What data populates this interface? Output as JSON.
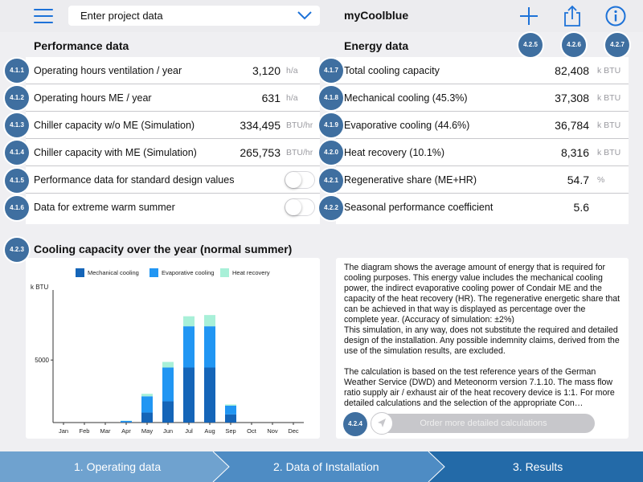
{
  "header": {
    "project_select_label": "Enter project data",
    "app_title": "myCoolblue",
    "icons": [
      "menu-icon",
      "chevron-down-icon",
      "plus-icon",
      "share-icon",
      "info-icon"
    ],
    "icon_badges": [
      "4.2.5",
      "4.2.6",
      "4.2.7"
    ]
  },
  "colors": {
    "accent": "#1d72d8",
    "badge": "#3f6fa0",
    "mechanical": "#1565b8",
    "evaporative": "#2196f3",
    "heat_recovery": "#a8f0d8",
    "step_light": "#6fa2cf",
    "step_mid": "#4e8cc4",
    "step_active": "#236aa8"
  },
  "performance": {
    "title": "Performance data",
    "rows": [
      {
        "badge": "4.1.1",
        "label": "Operating hours ventilation / year",
        "value": "3,120",
        "unit": "h/a"
      },
      {
        "badge": "4.1.2",
        "label": "Operating hours ME / year",
        "value": "631",
        "unit": "h/a"
      },
      {
        "badge": "4.1.3",
        "label": "Chiller capacity w/o ME (Simulation)",
        "value": "334,495",
        "unit": "BTU/hr"
      },
      {
        "badge": "4.1.4",
        "label": "Chiller capacity with ME (Simulation)",
        "value": "265,753",
        "unit": "BTU/hr"
      },
      {
        "badge": "4.1.5",
        "label": "Performance data for standard design values",
        "toggle": false
      },
      {
        "badge": "4.1.6",
        "label": "Data for extreme warm summer",
        "toggle": false
      }
    ]
  },
  "energy": {
    "title": "Energy data",
    "rows": [
      {
        "badge": "4.1.7",
        "label": "Total cooling capacity",
        "value": "82,408",
        "unit": "k BTU"
      },
      {
        "badge": "4.1.8",
        "label": "Mechanical cooling (45.3%)",
        "value": "37,308",
        "unit": "k BTU"
      },
      {
        "badge": "4.1.9",
        "label": "Evaporative cooling (44.6%)",
        "value": "36,784",
        "unit": "k BTU"
      },
      {
        "badge": "4.2.0",
        "label": "Heat recovery (10.1%)",
        "value": "8,316",
        "unit": "k BTU"
      },
      {
        "badge": "4.2.1",
        "label": "Regenerative share (ME+HR)",
        "value": "54.7",
        "unit": "%"
      },
      {
        "badge": "4.2.2",
        "label": "Seasonal performance coefficient",
        "value": "5.6",
        "unit": ""
      }
    ]
  },
  "chart_section": {
    "badge": "4.2.3",
    "title": "Cooling capacity over the year (normal summer)"
  },
  "chart_data": {
    "type": "bar",
    "stacked": true,
    "ylabel": "k BTU",
    "yticks": [
      5000
    ],
    "ylim": [
      0,
      10600
    ],
    "grid": false,
    "legend_position": "top",
    "categories": [
      "Jan",
      "Feb",
      "Mar",
      "Apr",
      "May",
      "Jun",
      "Jul",
      "Aug",
      "Sep",
      "Oct",
      "Nov",
      "Dec"
    ],
    "series": [
      {
        "name": "Mechanical cooling",
        "color": "#1565b8",
        "values": [
          0,
          0,
          0,
          50,
          800,
          1700,
          4400,
          4400,
          650,
          0,
          0,
          0
        ]
      },
      {
        "name": "Evaporative cooling",
        "color": "#2196f3",
        "values": [
          0,
          0,
          0,
          80,
          1300,
          2700,
          3300,
          3300,
          700,
          0,
          0,
          0
        ]
      },
      {
        "name": "Heat recovery",
        "color": "#a8f0d8",
        "values": [
          0,
          0,
          0,
          20,
          200,
          450,
          800,
          900,
          100,
          0,
          0,
          0
        ]
      }
    ]
  },
  "description": {
    "text": "The diagram shows the average amount of energy that is required for cooling purposes. This energy value includes the mechanical cooling power, the indirect evaporative cooling power of Condair ME and the capacity of the heat recovery (HR). The regenerative energetic share that can be achieved in that way is displayed as percentage over the complete year. (Accuracy of simulation: ±2%)\nThis simulation, in any way, does not substitute the required and detailed design of the installation. Any possible indemnity claims, derived from the use of the simulation results, are excluded.\n\nThe calculation is based on the test reference years of the German Weather Service (DWD) and Meteonorm version 7.1.10. The mass flow ratio supply air / exhaust air of the heat recovery device is 1:1. For more detailed calculations and the selection of the appropriate Con…",
    "badge": "4.2.4",
    "order_button": "Order more detailed calculations",
    "order_icon": "navigation-arrow-icon"
  },
  "steps": [
    {
      "label": "1. Operating data"
    },
    {
      "label": "2. Data of Installation"
    },
    {
      "label": "3. Results"
    }
  ]
}
